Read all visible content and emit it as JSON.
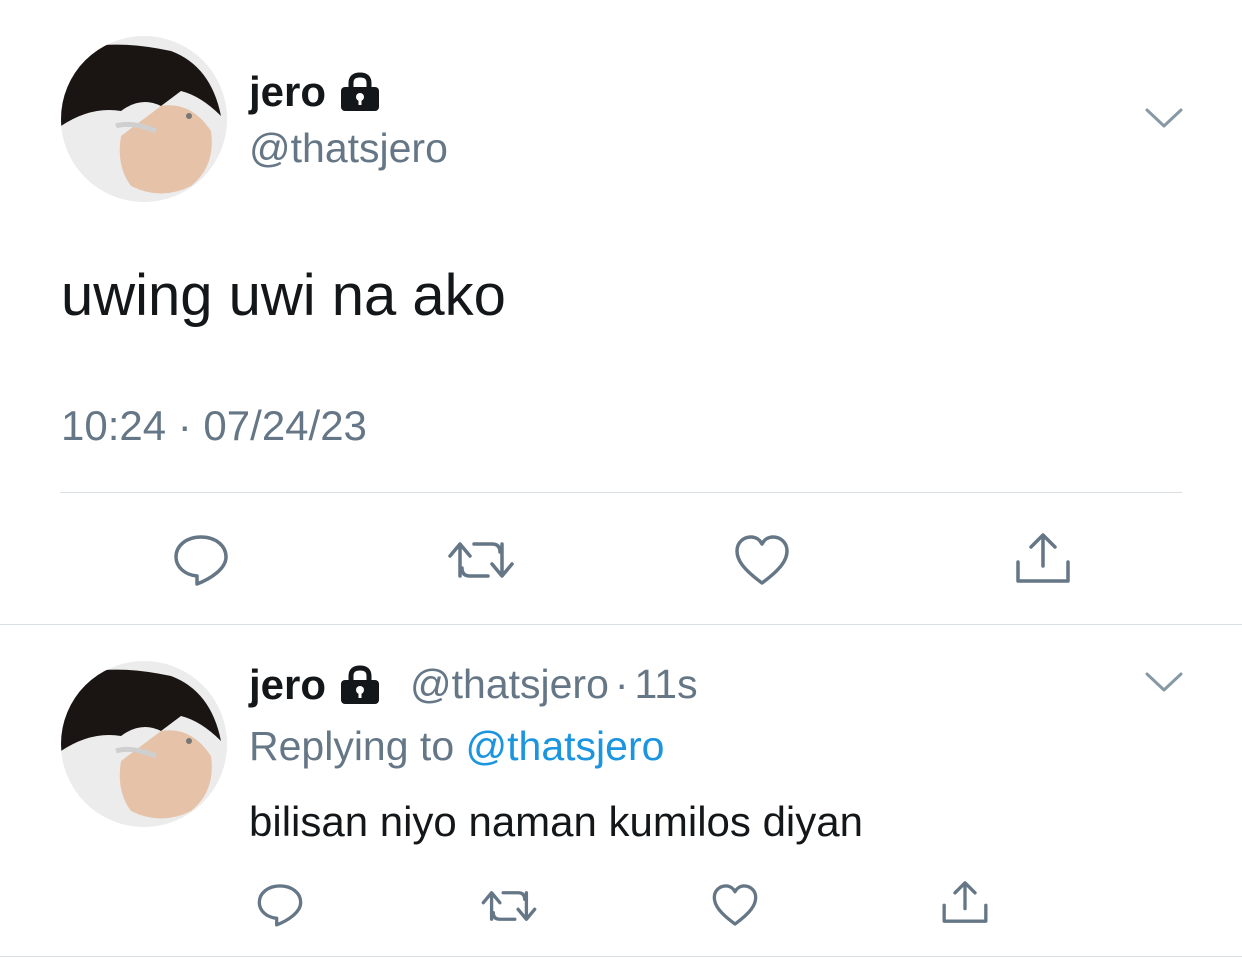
{
  "tweet": {
    "display_name": "jero",
    "handle": "@thatsjero",
    "protected_icon": "lock-icon",
    "text": "uwing uwi na ako",
    "timestamp": "10:24 · 07/24/23",
    "actions": [
      "reply-icon",
      "retweet-icon",
      "like-icon",
      "share-icon"
    ]
  },
  "reply": {
    "display_name": "jero",
    "handle": "@thatsjero",
    "separator": "·",
    "time_ago": "11s",
    "replying_prefix": "Replying to",
    "replying_mention": "@thatsjero",
    "text": "bilisan niyo naman kumilos diyan",
    "actions": [
      "reply-icon",
      "retweet-icon",
      "like-icon",
      "share-icon"
    ]
  },
  "colors": {
    "text_primary": "#14171a",
    "text_secondary": "#657786",
    "link": "#1b95e0",
    "divider": "#d9dee2"
  }
}
